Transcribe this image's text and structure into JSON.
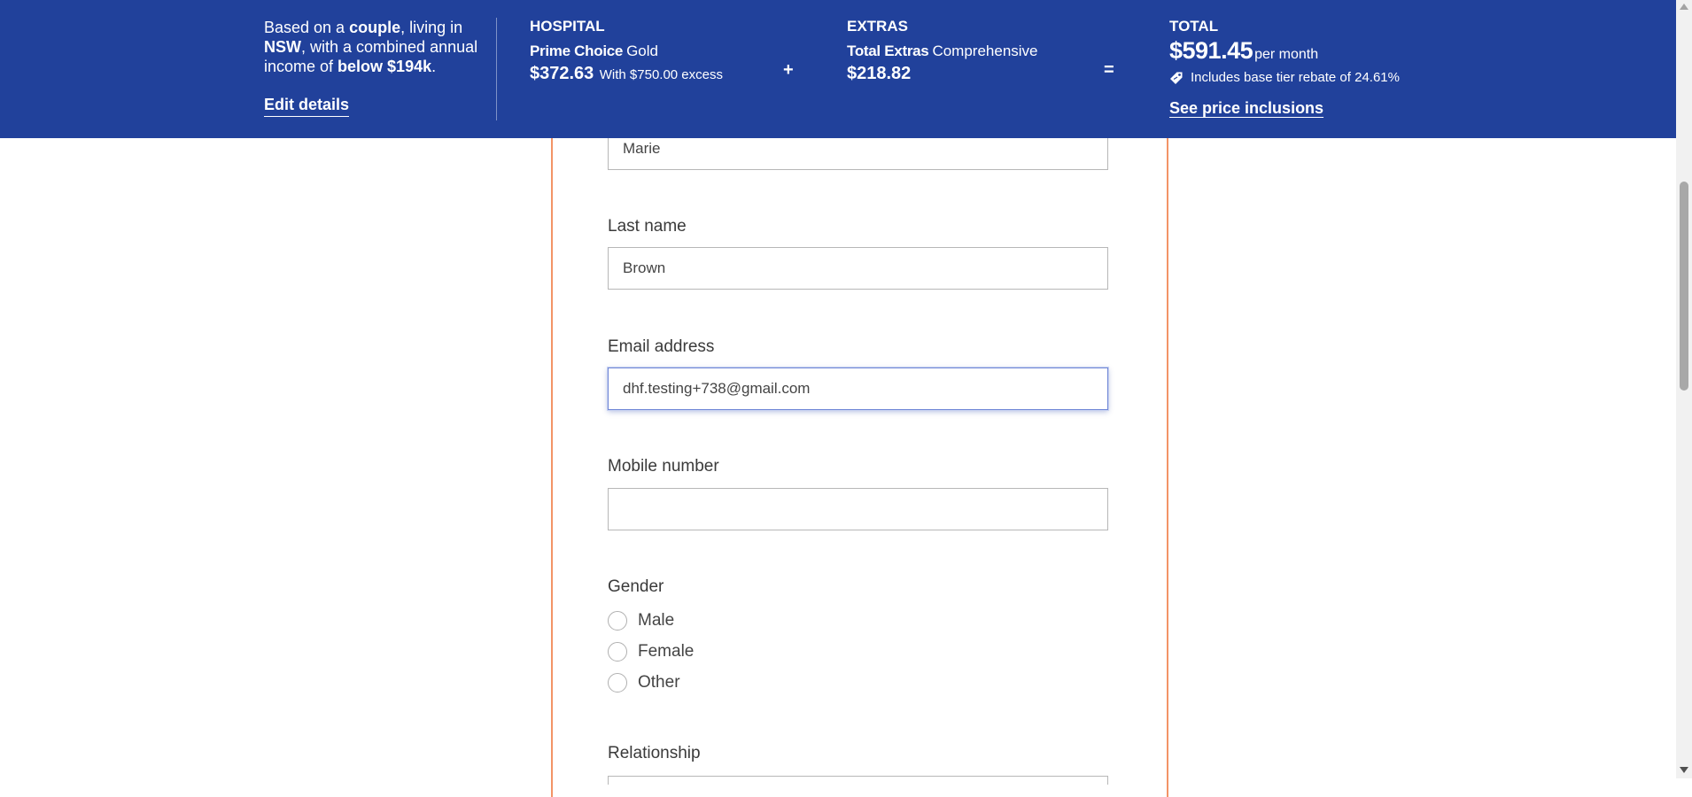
{
  "header": {
    "summary": {
      "p1": "Based on a ",
      "b1": "couple",
      "p2": ", living in ",
      "b2": "NSW",
      "p3": ", with a combined annual income of ",
      "b3": "below $194k",
      "p4": "."
    },
    "edit_link": "Edit details",
    "hospital": {
      "title": "HOSPITAL",
      "product": "Prime Choice",
      "tier": "Gold",
      "price": "$372.63",
      "excess": "With $750.00 excess"
    },
    "plus": "+",
    "extras": {
      "title": "EXTRAS",
      "product": "Total Extras",
      "tier": "Comprehensive",
      "price": "$218.82"
    },
    "equals": "=",
    "total": {
      "title": "TOTAL",
      "price": "$591.45",
      "period": "per month",
      "rebate": "Includes base tier rebate of 24.61%",
      "inclusions_link": "See price inclusions"
    }
  },
  "form": {
    "first_name_value": "Marie",
    "last_name_label": "Last name",
    "last_name_value": "Brown",
    "email_label": "Email address",
    "email_value": "dhf.testing+738@gmail.com",
    "mobile_label": "Mobile number",
    "mobile_value": "",
    "gender_label": "Gender",
    "gender_options": [
      "Male",
      "Female",
      "Other"
    ],
    "relationship_label": "Relationship"
  },
  "colors": {
    "header_bg": "#21419b",
    "card_border": "#f39466",
    "focus_ring": "#6f86d6"
  }
}
